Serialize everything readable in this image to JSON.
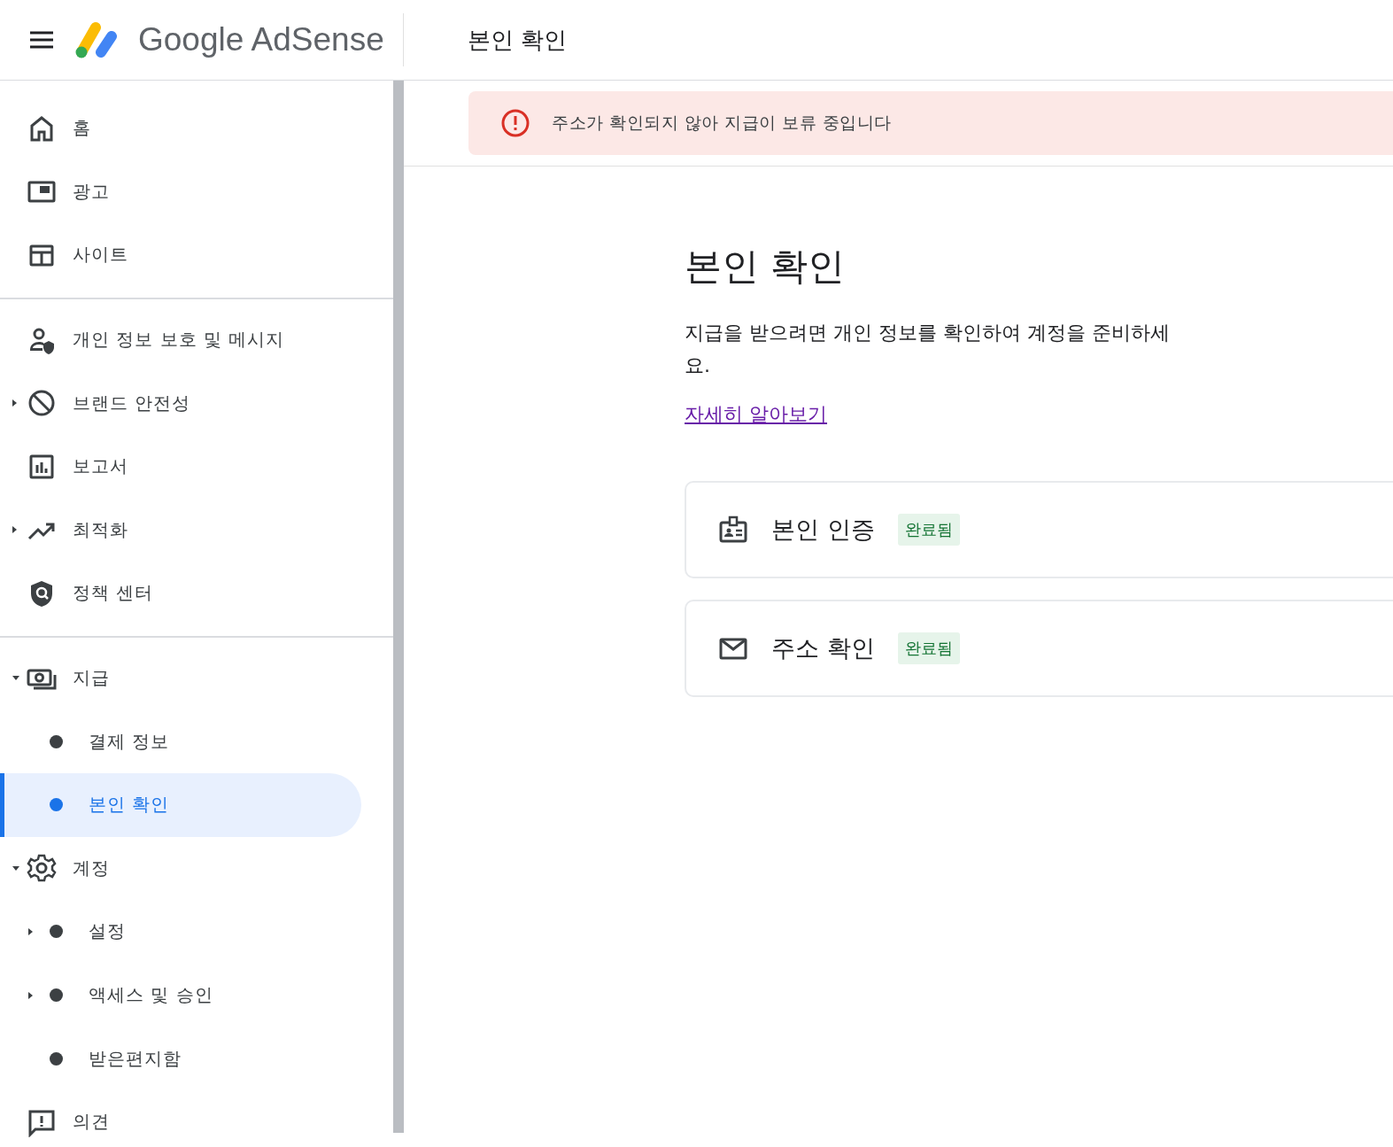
{
  "header": {
    "logo_text": "Google AdSense",
    "title": "본인 확인"
  },
  "sidebar": {
    "sections": [
      {
        "items": [
          {
            "label": "홈",
            "selected": false
          },
          {
            "label": "광고",
            "selected": false
          },
          {
            "label": "사이트",
            "selected": false
          }
        ]
      },
      {
        "items": [
          {
            "label": "개인 정보 보호 및 메시지",
            "selected": false
          },
          {
            "label": "브랜드 안전성",
            "selected": false,
            "expanded": false
          },
          {
            "label": "보고서",
            "selected": false
          },
          {
            "label": "최적화",
            "selected": false,
            "expanded": false
          },
          {
            "label": "정책 센터",
            "selected": false
          }
        ]
      },
      {
        "items": [
          {
            "label": "지급",
            "selected": false,
            "expanded": true,
            "children": [
              {
                "label": "결제 정보",
                "selected": false
              },
              {
                "label": "본인 확인",
                "selected": true
              }
            ]
          },
          {
            "label": "계정",
            "selected": false,
            "expanded": true,
            "children": [
              {
                "label": "설정",
                "selected": false,
                "expanded": false
              },
              {
                "label": "액세스 및 승인",
                "selected": false,
                "expanded": false
              },
              {
                "label": "받은편지함",
                "selected": false
              }
            ]
          },
          {
            "label": "의견",
            "selected": false
          }
        ]
      }
    ]
  },
  "alert": {
    "message": "주소가 확인되지 않아 지급이 보류 중입니다"
  },
  "main": {
    "title": "본인 확인",
    "description": "지급을 받으려면 개인 정보를 확인하여 계정을 준비하세요.",
    "link": "자세히 알아보기",
    "steps": [
      {
        "label": "본인 인증",
        "status": "완료됨"
      },
      {
        "label": "주소 확인",
        "status": "완료됨"
      }
    ]
  }
}
